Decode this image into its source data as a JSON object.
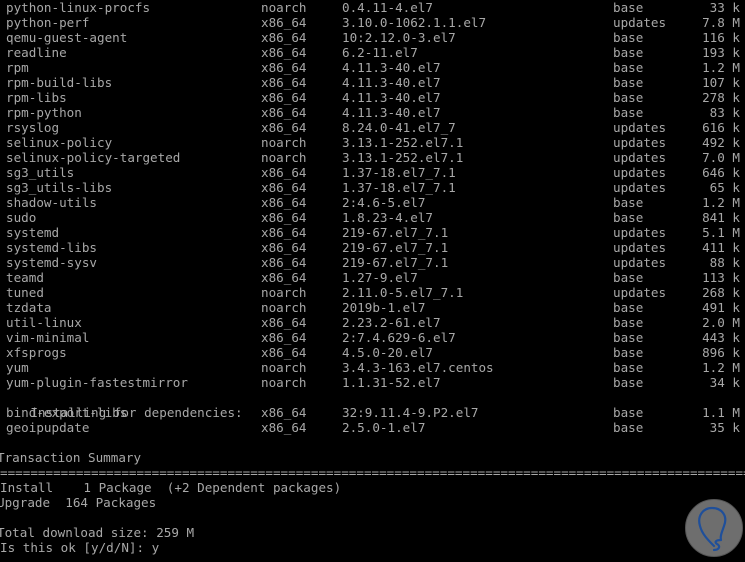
{
  "terminal": {
    "packages": [
      {
        "name": "python-linux-procfs",
        "arch": "noarch",
        "version": "0.4.11-4.el7",
        "repo": "base",
        "size": "33 k"
      },
      {
        "name": "python-perf",
        "arch": "x86_64",
        "version": "3.10.0-1062.1.1.el7",
        "repo": "updates",
        "size": "7.8 M"
      },
      {
        "name": "qemu-guest-agent",
        "arch": "x86_64",
        "version": "10:2.12.0-3.el7",
        "repo": "base",
        "size": "116 k"
      },
      {
        "name": "readline",
        "arch": "x86_64",
        "version": "6.2-11.el7",
        "repo": "base",
        "size": "193 k"
      },
      {
        "name": "rpm",
        "arch": "x86_64",
        "version": "4.11.3-40.el7",
        "repo": "base",
        "size": "1.2 M"
      },
      {
        "name": "rpm-build-libs",
        "arch": "x86_64",
        "version": "4.11.3-40.el7",
        "repo": "base",
        "size": "107 k"
      },
      {
        "name": "rpm-libs",
        "arch": "x86_64",
        "version": "4.11.3-40.el7",
        "repo": "base",
        "size": "278 k"
      },
      {
        "name": "rpm-python",
        "arch": "x86_64",
        "version": "4.11.3-40.el7",
        "repo": "base",
        "size": "83 k"
      },
      {
        "name": "rsyslog",
        "arch": "x86_64",
        "version": "8.24.0-41.el7_7",
        "repo": "updates",
        "size": "616 k"
      },
      {
        "name": "selinux-policy",
        "arch": "noarch",
        "version": "3.13.1-252.el7.1",
        "repo": "updates",
        "size": "492 k"
      },
      {
        "name": "selinux-policy-targeted",
        "arch": "noarch",
        "version": "3.13.1-252.el7.1",
        "repo": "updates",
        "size": "7.0 M"
      },
      {
        "name": "sg3_utils",
        "arch": "x86_64",
        "version": "1.37-18.el7_7.1",
        "repo": "updates",
        "size": "646 k"
      },
      {
        "name": "sg3_utils-libs",
        "arch": "x86_64",
        "version": "1.37-18.el7_7.1",
        "repo": "updates",
        "size": "65 k"
      },
      {
        "name": "shadow-utils",
        "arch": "x86_64",
        "version": "2:4.6-5.el7",
        "repo": "base",
        "size": "1.2 M"
      },
      {
        "name": "sudo",
        "arch": "x86_64",
        "version": "1.8.23-4.el7",
        "repo": "base",
        "size": "841 k"
      },
      {
        "name": "systemd",
        "arch": "x86_64",
        "version": "219-67.el7_7.1",
        "repo": "updates",
        "size": "5.1 M"
      },
      {
        "name": "systemd-libs",
        "arch": "x86_64",
        "version": "219-67.el7_7.1",
        "repo": "updates",
        "size": "411 k"
      },
      {
        "name": "systemd-sysv",
        "arch": "x86_64",
        "version": "219-67.el7_7.1",
        "repo": "updates",
        "size": "88 k"
      },
      {
        "name": "teamd",
        "arch": "x86_64",
        "version": "1.27-9.el7",
        "repo": "base",
        "size": "113 k"
      },
      {
        "name": "tuned",
        "arch": "noarch",
        "version": "2.11.0-5.el7_7.1",
        "repo": "updates",
        "size": "268 k"
      },
      {
        "name": "tzdata",
        "arch": "noarch",
        "version": "2019b-1.el7",
        "repo": "base",
        "size": "491 k"
      },
      {
        "name": "util-linux",
        "arch": "x86_64",
        "version": "2.23.2-61.el7",
        "repo": "base",
        "size": "2.0 M"
      },
      {
        "name": "vim-minimal",
        "arch": "x86_64",
        "version": "2:7.4.629-6.el7",
        "repo": "base",
        "size": "443 k"
      },
      {
        "name": "xfsprogs",
        "arch": "x86_64",
        "version": "4.5.0-20.el7",
        "repo": "base",
        "size": "896 k"
      },
      {
        "name": "yum",
        "arch": "noarch",
        "version": "3.4.3-163.el7.centos",
        "repo": "base",
        "size": "1.2 M"
      },
      {
        "name": "yum-plugin-fastestmirror",
        "arch": "noarch",
        "version": "1.1.31-52.el7",
        "repo": "base",
        "size": "34 k"
      }
    ],
    "dependencies_header": "Installing for dependencies:",
    "dependencies": [
      {
        "name": "bind-export-libs",
        "arch": "x86_64",
        "version": "32:9.11.4-9.P2.el7",
        "repo": "base",
        "size": "1.1 M"
      },
      {
        "name": "geoipupdate",
        "arch": "x86_64",
        "version": "2.5.0-1.el7",
        "repo": "base",
        "size": "35 k"
      }
    ],
    "summary_title": "Transaction Summary",
    "separator": "====================================================================================================",
    "install_line": "Install    1 Package  (+2 Dependent packages)",
    "upgrade_line": "Upgrade  164 Packages",
    "total_download": "Total download size: 259 M",
    "prompt": "Is this ok [y/d/N]: y"
  },
  "watermark": {
    "icon": "lightbulb-logo-icon",
    "circle_color": "#6e6e6e",
    "stroke_color": "#1f4f9a"
  }
}
